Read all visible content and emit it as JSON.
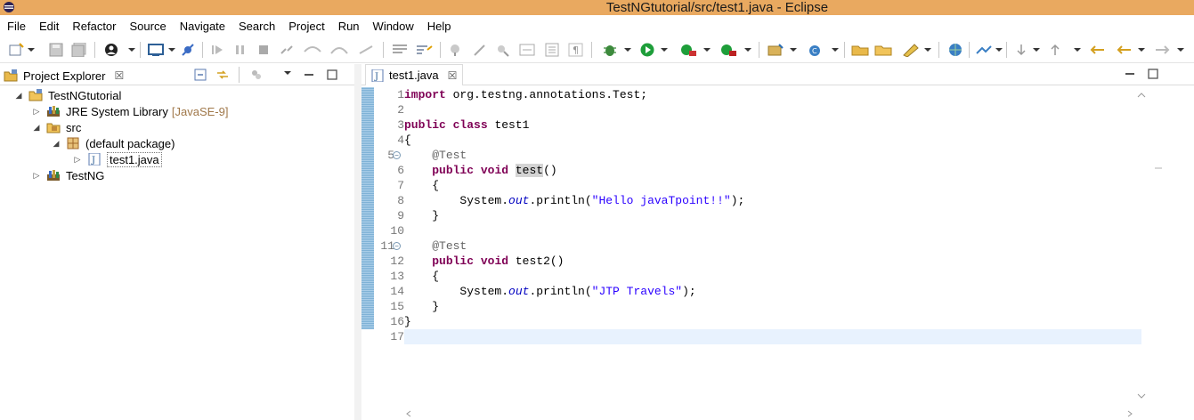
{
  "window": {
    "title": "TestNGtutorial/src/test1.java - Eclipse"
  },
  "menu": [
    "File",
    "Edit",
    "Refactor",
    "Source",
    "Navigate",
    "Search",
    "Project",
    "Run",
    "Window",
    "Help"
  ],
  "explorer": {
    "tab_label": "Project Explorer",
    "close_glyph": "☒",
    "tree": [
      {
        "label": "TestNGtutorial",
        "expanded": true,
        "icon": "project-icon"
      },
      {
        "label": "JRE System Library",
        "decoration": "[JavaSE-9]",
        "expanded": false,
        "icon": "library-icon"
      },
      {
        "label": "src",
        "expanded": true,
        "icon": "source-folder-icon"
      },
      {
        "label": "(default package)",
        "expanded": true,
        "icon": "package-icon"
      },
      {
        "label": "test1.java",
        "expanded": false,
        "icon": "java-file-icon",
        "selected": true
      },
      {
        "label": "TestNG",
        "expanded": false,
        "icon": "library-icon"
      }
    ]
  },
  "editor": {
    "tab_label": "test1.java",
    "close_glyph": "☒",
    "line_numbers": [
      "1",
      "2",
      "3",
      "4",
      "5",
      "6",
      "7",
      "8",
      "9",
      "10",
      "11",
      "12",
      "13",
      "14",
      "15",
      "16",
      "17"
    ],
    "current_line": 17,
    "fold_lines": [
      5,
      11
    ],
    "code": {
      "l1_kw": "import",
      "l1_rest": " org.testng.annotations.Test;",
      "l3_kw1": "public",
      "l3_kw2": "class",
      "l3_rest": " test1",
      "l4": "{",
      "l5_ann": "@Test",
      "l6_kw1": "public",
      "l6_kw2": "void",
      "l6_name": "test",
      "l6_rest": "()",
      "l7": "{",
      "l8_pre": "System.",
      "l8_field": "out",
      "l8_mid": ".println(",
      "l8_str": "\"Hello javaTpoint!!\"",
      "l8_end": ");",
      "l9": "}",
      "l11_ann": "@Test",
      "l12_kw1": "public",
      "l12_kw2": "void",
      "l12_rest": " test2()",
      "l13": "{",
      "l14_pre": "System.",
      "l14_field": "out",
      "l14_mid": ".println(",
      "l14_str": "\"JTP Travels\"",
      "l14_end": ");",
      "l15": "}",
      "l16": "}"
    }
  },
  "colors": {
    "title_bar": "#e9a960",
    "keyword": "#7f0055",
    "string": "#2a00ff",
    "annotation": "#646464",
    "field": "#0000c0",
    "current_line": "#e8f2fe"
  }
}
